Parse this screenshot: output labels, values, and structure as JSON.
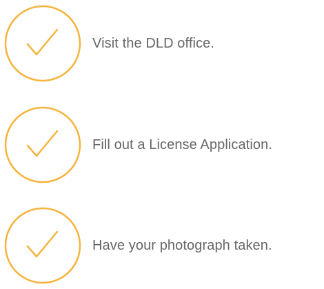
{
  "accent_color": "#f5b43c",
  "text_color": "#666666",
  "steps": [
    {
      "icon": "check-circle-icon",
      "label": "Visit the DLD office."
    },
    {
      "icon": "check-circle-icon",
      "label": "Fill out a License Application."
    },
    {
      "icon": "check-circle-icon",
      "label": "Have your photograph taken."
    }
  ]
}
